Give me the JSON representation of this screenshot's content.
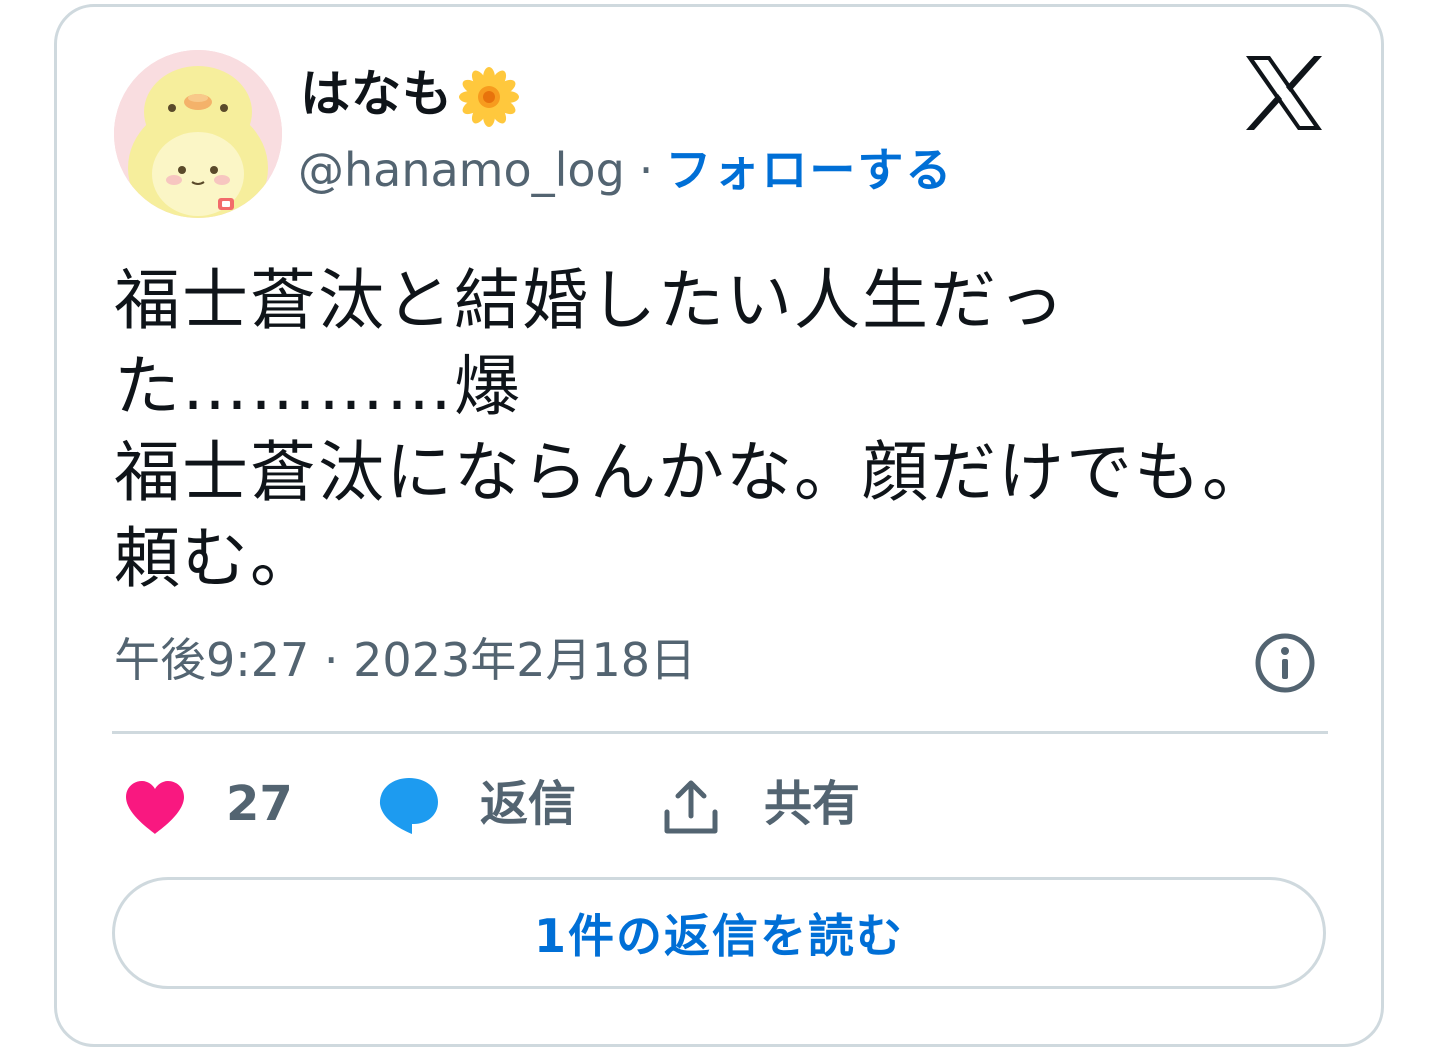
{
  "author": {
    "display_name": "はなも",
    "handle": "@hanamo_log",
    "separator": "·",
    "follow_label": "フォローする",
    "avatar_icon": "chick-avatar",
    "name_emoji_icon": "flower-icon"
  },
  "brand": {
    "logo": "x-logo-icon"
  },
  "tweet": {
    "lines": [
      "福士蒼汰と結婚したい人生だっ",
      "た…………爆",
      "福士蒼汰にならんかな。顔だけでも。",
      "頼む。"
    ],
    "timestamp": "午後9:27 · 2023年2月18日"
  },
  "actions": {
    "like_count": "27",
    "reply_label": "返信",
    "share_label": "共有"
  },
  "read_replies_label": "1件の返信を読む",
  "colors": {
    "accent": "#006fd6",
    "like": "#f91880",
    "reply": "#1d9bf0",
    "muted": "#536471",
    "border": "#cfd9de"
  }
}
